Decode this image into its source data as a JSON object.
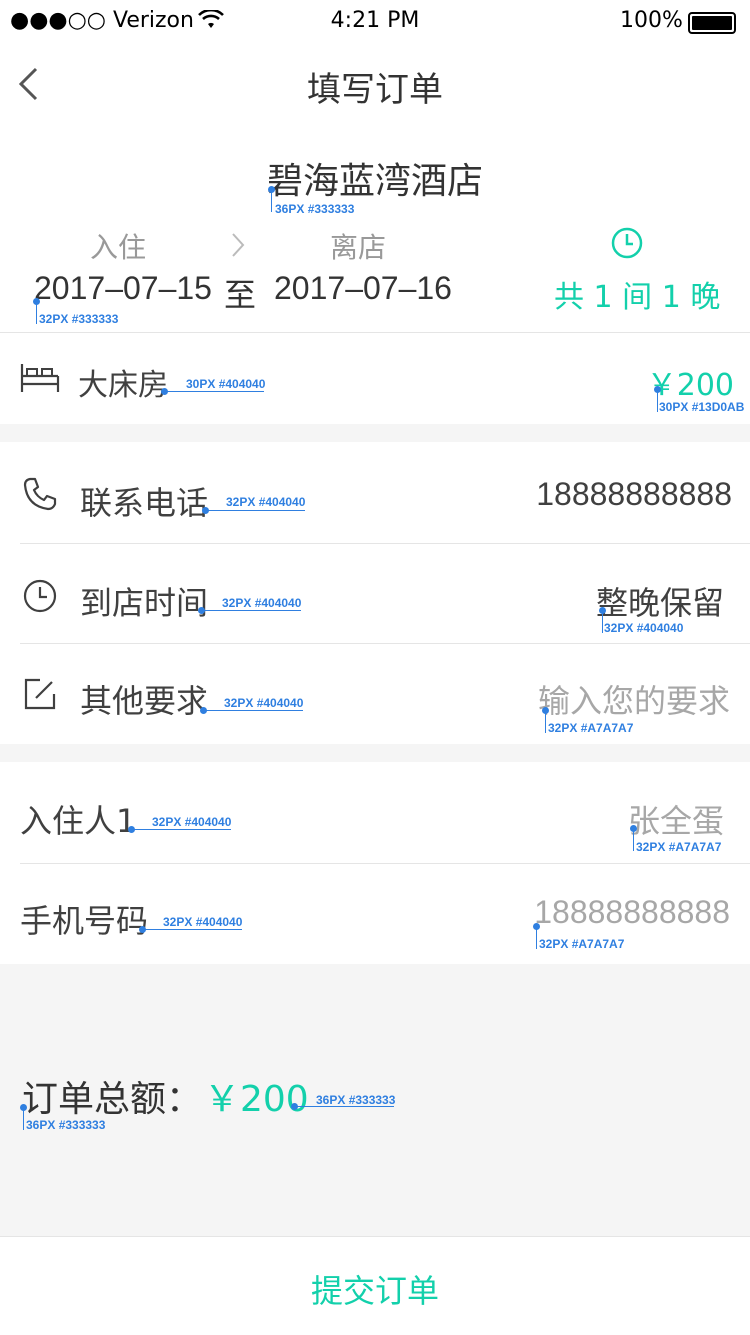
{
  "status_bar": {
    "carrier": "●●●○○ Verizon",
    "time": "4:21 PM",
    "battery": "100%"
  },
  "nav": {
    "title": "填写订单"
  },
  "hotel": {
    "name": "碧海蓝湾酒店"
  },
  "stay": {
    "checkin_label": "入住",
    "checkout_label": "离店",
    "checkin_date": "2017–07–15",
    "to_text": "至",
    "checkout_date": "2017–07–16",
    "summary": "共 1 间 1 晚"
  },
  "room": {
    "type": "大床房",
    "price": "￥200"
  },
  "contact": {
    "phone_label": "联系电话",
    "phone_value": "18888888888",
    "arrival_label": "到店时间",
    "arrival_value": "整晚保留",
    "other_label": "其他要求",
    "other_placeholder": "输入您的要求"
  },
  "guest": {
    "name_label": "入住人1",
    "name_placeholder": "张全蛋",
    "mobile_label": "手机号码",
    "mobile_placeholder": "18888888888"
  },
  "total": {
    "label": "订单总额：",
    "amount": "￥200"
  },
  "submit_label": "提交订单",
  "annotations": {
    "hotel": "36PX #333333",
    "date": "32PX #333333",
    "room": "30PX #404040",
    "price": "30PX #13D0AB",
    "phone": "32PX #404040",
    "arrival": "32PX #404040",
    "arrival_val": "32PX #404040",
    "other": "32PX #404040",
    "other_val": "32PX #A7A7A7",
    "guest": "32PX #404040",
    "guest_val": "32PX #A7A7A7",
    "mobile": "32PX #404040",
    "mobile_val": "32PX #A7A7A7",
    "total": "36PX #333333",
    "total_amt": "36PX #333333"
  },
  "colors": {
    "accent": "#13D0AB",
    "text": "#333333",
    "label": "#404040",
    "placeholder": "#A7A7A7"
  }
}
